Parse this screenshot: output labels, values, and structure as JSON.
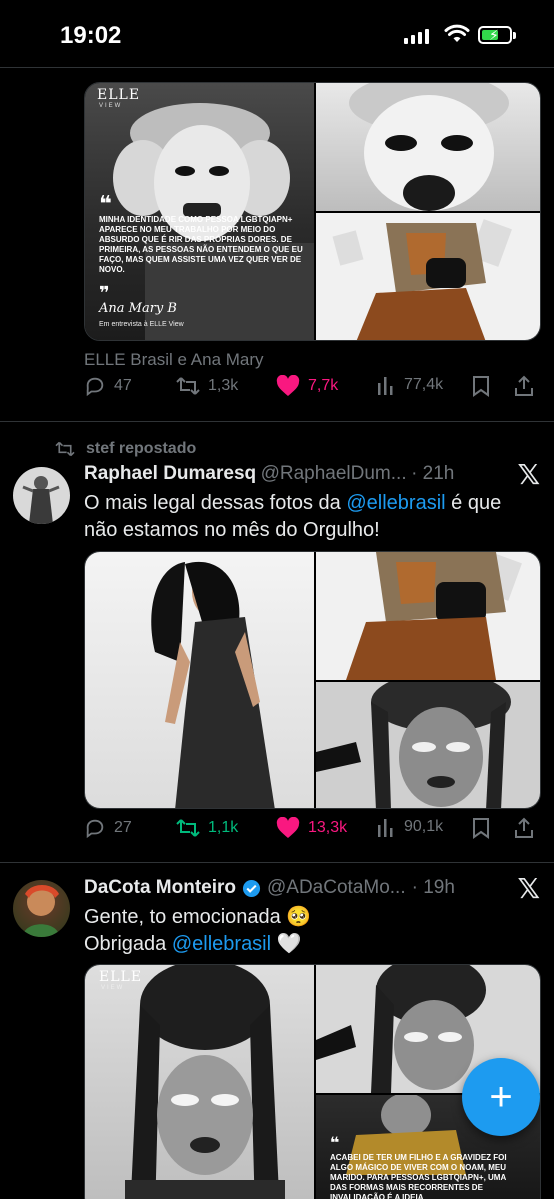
{
  "status_bar": {
    "time": "19:02"
  },
  "post1": {
    "magazine_overlay": {
      "logo": "ELLE",
      "logo_sub": "VIEW",
      "quote": "Minha identidade como pessoa LGBTQIAPN+ aparece no meu trabalho por meio do absurdo que é rir das próprias dores. De primeira, as pessoas não entendem o que eu faço, mas quem assiste uma vez quer ver de novo.",
      "signature": "Ana Mary B",
      "credit": "Em entrevista à ELLE View"
    },
    "tagged": "ELLE Brasil e Ana Mary",
    "replies": "47",
    "reposts": "1,3k",
    "likes": "7,7k",
    "views": "77,4k"
  },
  "post2": {
    "repost_label": "stef repostado",
    "name": "Raphael Dumaresq",
    "handle": "@RaphaelDum...",
    "time": "· 21h",
    "text_before": "O mais legal dessas fotos da ",
    "mention": "@ellebrasil",
    "text_after": " é que não estamos no mês do Orgulho!",
    "replies": "27",
    "reposts": "1,1k",
    "likes": "13,3k",
    "views": "90,1k"
  },
  "post3": {
    "name": "DaCota Monteiro",
    "handle": "@ADaCotaMo...",
    "time": "· 19h",
    "line1": "Gente, to emocionada 🥺",
    "line2_before": "Obrigada ",
    "mention": "@ellebrasil",
    "heart": "🤍",
    "magazine_overlay": {
      "logo": "ELLE",
      "logo_sub": "VIEW",
      "quote": "Acabei de ter um filho e a gravidez foi algo mágico de viver com o Noam, meu marido. Para pessoas LGBTQIAPN+, uma das formas mais recorrentes de invalidação é a ideia"
    }
  },
  "fab": {
    "label": "+"
  },
  "colors": {
    "accent": "#1d9bf0",
    "like": "#f91880",
    "repost_active": "#00ba7c",
    "muted": "#71767b"
  }
}
